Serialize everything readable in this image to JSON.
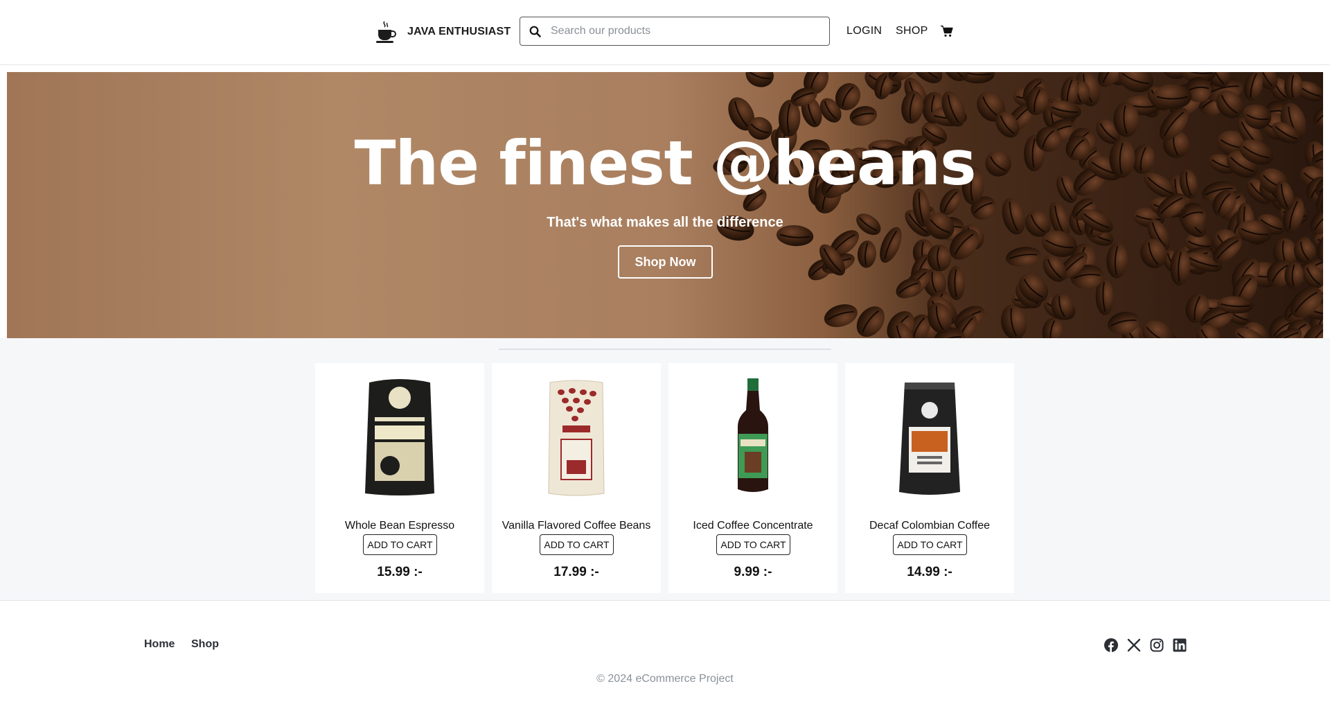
{
  "header": {
    "brand_name": "JAVA ENTHUSIAST",
    "brand_icon": "coffee-cup-icon",
    "search": {
      "placeholder": "Search our products",
      "value": "",
      "icon": "search-icon"
    },
    "nav": {
      "login": "LOGIN",
      "shop": "SHOP"
    },
    "cart_icon": "shopping-cart-icon"
  },
  "hero": {
    "title": "The finest @beans",
    "subtitle": "That's what makes all the difference",
    "button_label": "Shop Now"
  },
  "products": [
    {
      "name": "Whole Bean Espresso",
      "button": "ADD TO CART",
      "price": "15.99 :-"
    },
    {
      "name": "Vanilla Flavored Coffee Beans",
      "button": "ADD TO CART",
      "price": "17.99 :-"
    },
    {
      "name": "Iced Coffee Concentrate",
      "button": "ADD TO CART",
      "price": "9.99 :-"
    },
    {
      "name": "Decaf Colombian Coffee",
      "button": "ADD TO CART",
      "price": "14.99 :-"
    }
  ],
  "footer": {
    "links": {
      "home": "Home",
      "shop": "Shop"
    },
    "social_icons": [
      "facebook-icon",
      "x-icon",
      "instagram-icon",
      "linkedin-icon"
    ],
    "copyright": "© 2024 eCommerce Project"
  },
  "colors": {
    "page_background": "#f6f7f9",
    "text": "#111111",
    "footer_link": "#2b2f36",
    "muted": "#8a9099"
  }
}
